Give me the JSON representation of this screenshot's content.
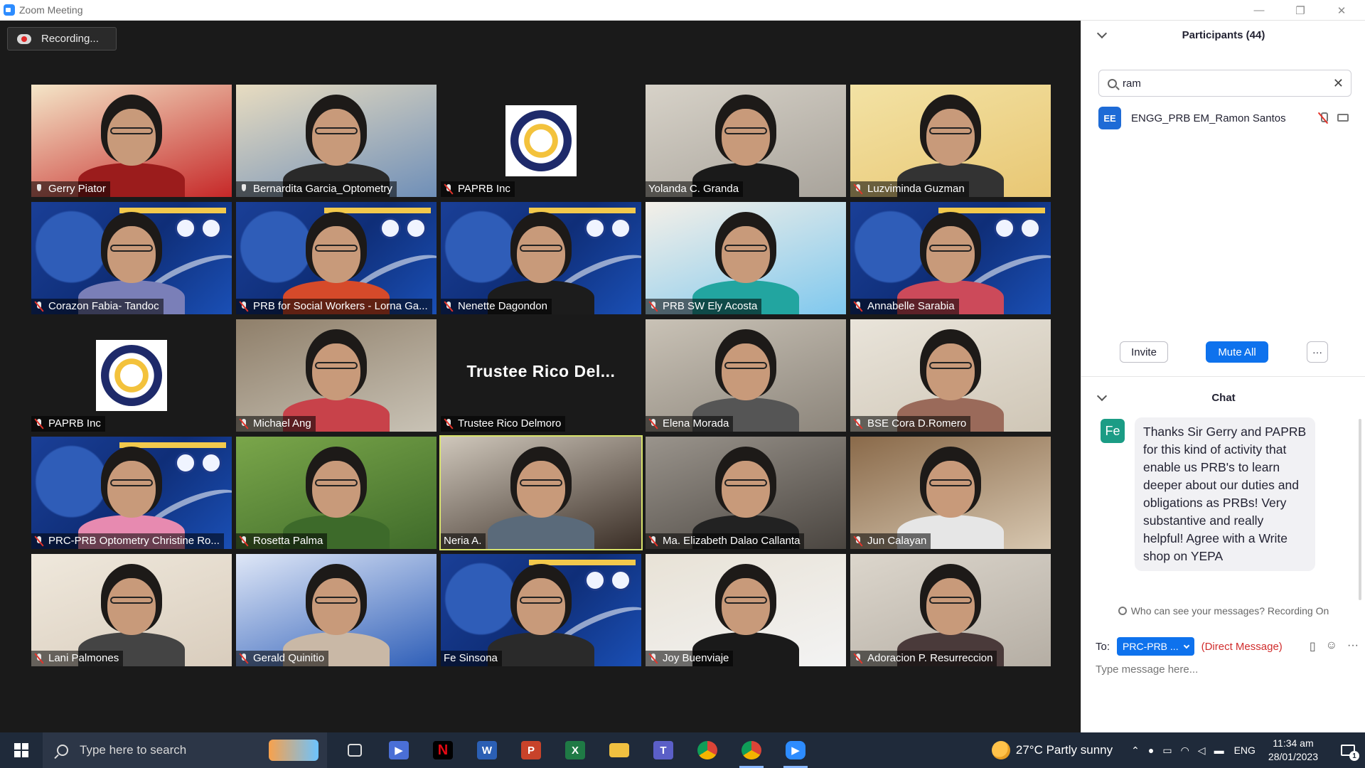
{
  "window": {
    "title": "Zoom Meeting",
    "minimize": "—",
    "restore": "❐",
    "close": "✕"
  },
  "recording": {
    "label": "Recording..."
  },
  "participants_panel": {
    "title": "Participants (44)",
    "search_value": "ram",
    "search_placeholder": "",
    "result": {
      "initials": "EE",
      "name": "ENGG_PRB EM_Ramon Santos"
    },
    "invite": "Invite",
    "mute_all": "Mute All",
    "more": "···"
  },
  "chat": {
    "title": "Chat",
    "sender_initials": "Fe",
    "message": "Thanks Sir Gerry and PAPRB for this kind of activity that enable us PRB's to learn deeper about our duties and obligations as PRBs! Very substantive and really helpful! Agree with a Write shop on YEPA",
    "who_can_see": "Who can see your messages? Recording On",
    "to_label": "To:",
    "to_value": "PRC-PRB ...",
    "direct_message": "(Direct Message)",
    "input_placeholder": "Type message here..."
  },
  "tiles": [
    {
      "name": "Gerry Piator",
      "mic": "pin"
    },
    {
      "name": "Bernardita Garcia_Optometry",
      "mic": "pin"
    },
    {
      "name": "PAPRB Inc",
      "mic": "muted"
    },
    {
      "name": "Yolanda C. Granda",
      "mic": "none"
    },
    {
      "name": "Luzviminda Guzman",
      "mic": "muted"
    },
    {
      "name": "Corazon Fabia- Tandoc",
      "mic": "muted"
    },
    {
      "name": "PRB for Social Workers - Lorna Ga...",
      "mic": "muted"
    },
    {
      "name": "Nenette Dagondon",
      "mic": "muted"
    },
    {
      "name": "PRB SW Ely Acosta",
      "mic": "muted"
    },
    {
      "name": "Annabelle Sarabia",
      "mic": "muted"
    },
    {
      "name": "PAPRB Inc",
      "mic": "muted"
    },
    {
      "name": "Michael Ang",
      "mic": "muted"
    },
    {
      "name": "Trustee Rico Delmoro",
      "mic": "muted",
      "big": "Trustee  Rico  Del..."
    },
    {
      "name": "Elena Morada",
      "mic": "muted"
    },
    {
      "name": "BSE Cora D.Romero",
      "mic": "muted"
    },
    {
      "name": "PRC-PRB Optometry Christine Ro...",
      "mic": "muted"
    },
    {
      "name": "Rosetta Palma",
      "mic": "muted"
    },
    {
      "name": "Neria A.",
      "mic": "none"
    },
    {
      "name": "Ma. Elizabeth Dalao Callanta",
      "mic": "muted"
    },
    {
      "name": "Jun Calayan",
      "mic": "muted"
    },
    {
      "name": "Lani Palmones",
      "mic": "muted"
    },
    {
      "name": "Gerald Quinitio",
      "mic": "muted"
    },
    {
      "name": "Fe Sinsona",
      "mic": "none"
    },
    {
      "name": "Joy Buenviaje",
      "mic": "muted"
    },
    {
      "name": "Adoracion P. Resurreccion",
      "mic": "muted"
    }
  ],
  "taskbar": {
    "search_placeholder": "Type here to search",
    "weather": "27°C  Partly sunny",
    "lang": "ENG",
    "time": "11:34 am",
    "date": "28/01/2023",
    "notifications": "1"
  }
}
